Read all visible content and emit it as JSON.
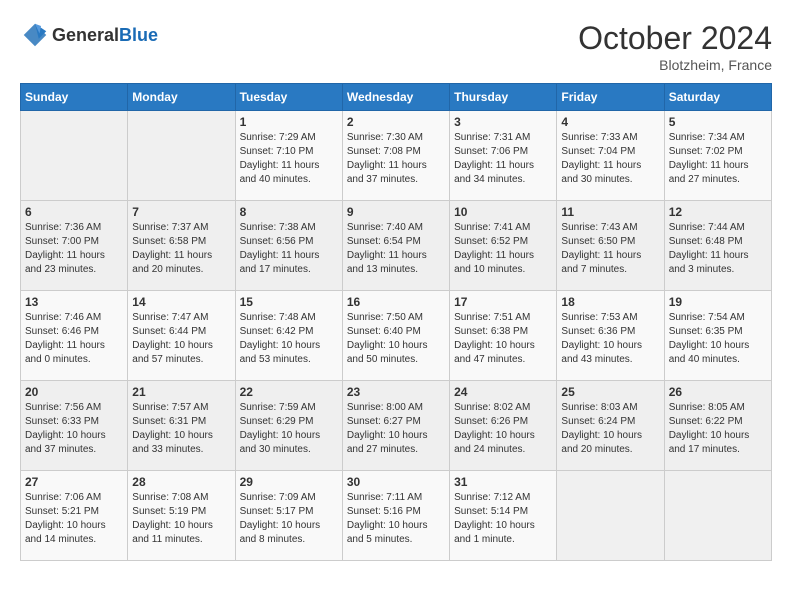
{
  "header": {
    "logo_general": "General",
    "logo_blue": "Blue",
    "month_year": "October 2024",
    "location": "Blotzheim, France"
  },
  "days_of_week": [
    "Sunday",
    "Monday",
    "Tuesday",
    "Wednesday",
    "Thursday",
    "Friday",
    "Saturday"
  ],
  "weeks": [
    [
      {
        "day": "",
        "sunrise": "",
        "sunset": "",
        "daylight": ""
      },
      {
        "day": "",
        "sunrise": "",
        "sunset": "",
        "daylight": ""
      },
      {
        "day": "1",
        "sunrise": "Sunrise: 7:29 AM",
        "sunset": "Sunset: 7:10 PM",
        "daylight": "Daylight: 11 hours and 40 minutes."
      },
      {
        "day": "2",
        "sunrise": "Sunrise: 7:30 AM",
        "sunset": "Sunset: 7:08 PM",
        "daylight": "Daylight: 11 hours and 37 minutes."
      },
      {
        "day": "3",
        "sunrise": "Sunrise: 7:31 AM",
        "sunset": "Sunset: 7:06 PM",
        "daylight": "Daylight: 11 hours and 34 minutes."
      },
      {
        "day": "4",
        "sunrise": "Sunrise: 7:33 AM",
        "sunset": "Sunset: 7:04 PM",
        "daylight": "Daylight: 11 hours and 30 minutes."
      },
      {
        "day": "5",
        "sunrise": "Sunrise: 7:34 AM",
        "sunset": "Sunset: 7:02 PM",
        "daylight": "Daylight: 11 hours and 27 minutes."
      }
    ],
    [
      {
        "day": "6",
        "sunrise": "Sunrise: 7:36 AM",
        "sunset": "Sunset: 7:00 PM",
        "daylight": "Daylight: 11 hours and 23 minutes."
      },
      {
        "day": "7",
        "sunrise": "Sunrise: 7:37 AM",
        "sunset": "Sunset: 6:58 PM",
        "daylight": "Daylight: 11 hours and 20 minutes."
      },
      {
        "day": "8",
        "sunrise": "Sunrise: 7:38 AM",
        "sunset": "Sunset: 6:56 PM",
        "daylight": "Daylight: 11 hours and 17 minutes."
      },
      {
        "day": "9",
        "sunrise": "Sunrise: 7:40 AM",
        "sunset": "Sunset: 6:54 PM",
        "daylight": "Daylight: 11 hours and 13 minutes."
      },
      {
        "day": "10",
        "sunrise": "Sunrise: 7:41 AM",
        "sunset": "Sunset: 6:52 PM",
        "daylight": "Daylight: 11 hours and 10 minutes."
      },
      {
        "day": "11",
        "sunrise": "Sunrise: 7:43 AM",
        "sunset": "Sunset: 6:50 PM",
        "daylight": "Daylight: 11 hours and 7 minutes."
      },
      {
        "day": "12",
        "sunrise": "Sunrise: 7:44 AM",
        "sunset": "Sunset: 6:48 PM",
        "daylight": "Daylight: 11 hours and 3 minutes."
      }
    ],
    [
      {
        "day": "13",
        "sunrise": "Sunrise: 7:46 AM",
        "sunset": "Sunset: 6:46 PM",
        "daylight": "Daylight: 11 hours and 0 minutes."
      },
      {
        "day": "14",
        "sunrise": "Sunrise: 7:47 AM",
        "sunset": "Sunset: 6:44 PM",
        "daylight": "Daylight: 10 hours and 57 minutes."
      },
      {
        "day": "15",
        "sunrise": "Sunrise: 7:48 AM",
        "sunset": "Sunset: 6:42 PM",
        "daylight": "Daylight: 10 hours and 53 minutes."
      },
      {
        "day": "16",
        "sunrise": "Sunrise: 7:50 AM",
        "sunset": "Sunset: 6:40 PM",
        "daylight": "Daylight: 10 hours and 50 minutes."
      },
      {
        "day": "17",
        "sunrise": "Sunrise: 7:51 AM",
        "sunset": "Sunset: 6:38 PM",
        "daylight": "Daylight: 10 hours and 47 minutes."
      },
      {
        "day": "18",
        "sunrise": "Sunrise: 7:53 AM",
        "sunset": "Sunset: 6:36 PM",
        "daylight": "Daylight: 10 hours and 43 minutes."
      },
      {
        "day": "19",
        "sunrise": "Sunrise: 7:54 AM",
        "sunset": "Sunset: 6:35 PM",
        "daylight": "Daylight: 10 hours and 40 minutes."
      }
    ],
    [
      {
        "day": "20",
        "sunrise": "Sunrise: 7:56 AM",
        "sunset": "Sunset: 6:33 PM",
        "daylight": "Daylight: 10 hours and 37 minutes."
      },
      {
        "day": "21",
        "sunrise": "Sunrise: 7:57 AM",
        "sunset": "Sunset: 6:31 PM",
        "daylight": "Daylight: 10 hours and 33 minutes."
      },
      {
        "day": "22",
        "sunrise": "Sunrise: 7:59 AM",
        "sunset": "Sunset: 6:29 PM",
        "daylight": "Daylight: 10 hours and 30 minutes."
      },
      {
        "day": "23",
        "sunrise": "Sunrise: 8:00 AM",
        "sunset": "Sunset: 6:27 PM",
        "daylight": "Daylight: 10 hours and 27 minutes."
      },
      {
        "day": "24",
        "sunrise": "Sunrise: 8:02 AM",
        "sunset": "Sunset: 6:26 PM",
        "daylight": "Daylight: 10 hours and 24 minutes."
      },
      {
        "day": "25",
        "sunrise": "Sunrise: 8:03 AM",
        "sunset": "Sunset: 6:24 PM",
        "daylight": "Daylight: 10 hours and 20 minutes."
      },
      {
        "day": "26",
        "sunrise": "Sunrise: 8:05 AM",
        "sunset": "Sunset: 6:22 PM",
        "daylight": "Daylight: 10 hours and 17 minutes."
      }
    ],
    [
      {
        "day": "27",
        "sunrise": "Sunrise: 7:06 AM",
        "sunset": "Sunset: 5:21 PM",
        "daylight": "Daylight: 10 hours and 14 minutes."
      },
      {
        "day": "28",
        "sunrise": "Sunrise: 7:08 AM",
        "sunset": "Sunset: 5:19 PM",
        "daylight": "Daylight: 10 hours and 11 minutes."
      },
      {
        "day": "29",
        "sunrise": "Sunrise: 7:09 AM",
        "sunset": "Sunset: 5:17 PM",
        "daylight": "Daylight: 10 hours and 8 minutes."
      },
      {
        "day": "30",
        "sunrise": "Sunrise: 7:11 AM",
        "sunset": "Sunset: 5:16 PM",
        "daylight": "Daylight: 10 hours and 5 minutes."
      },
      {
        "day": "31",
        "sunrise": "Sunrise: 7:12 AM",
        "sunset": "Sunset: 5:14 PM",
        "daylight": "Daylight: 10 hours and 1 minute."
      },
      {
        "day": "",
        "sunrise": "",
        "sunset": "",
        "daylight": ""
      },
      {
        "day": "",
        "sunrise": "",
        "sunset": "",
        "daylight": ""
      }
    ]
  ]
}
